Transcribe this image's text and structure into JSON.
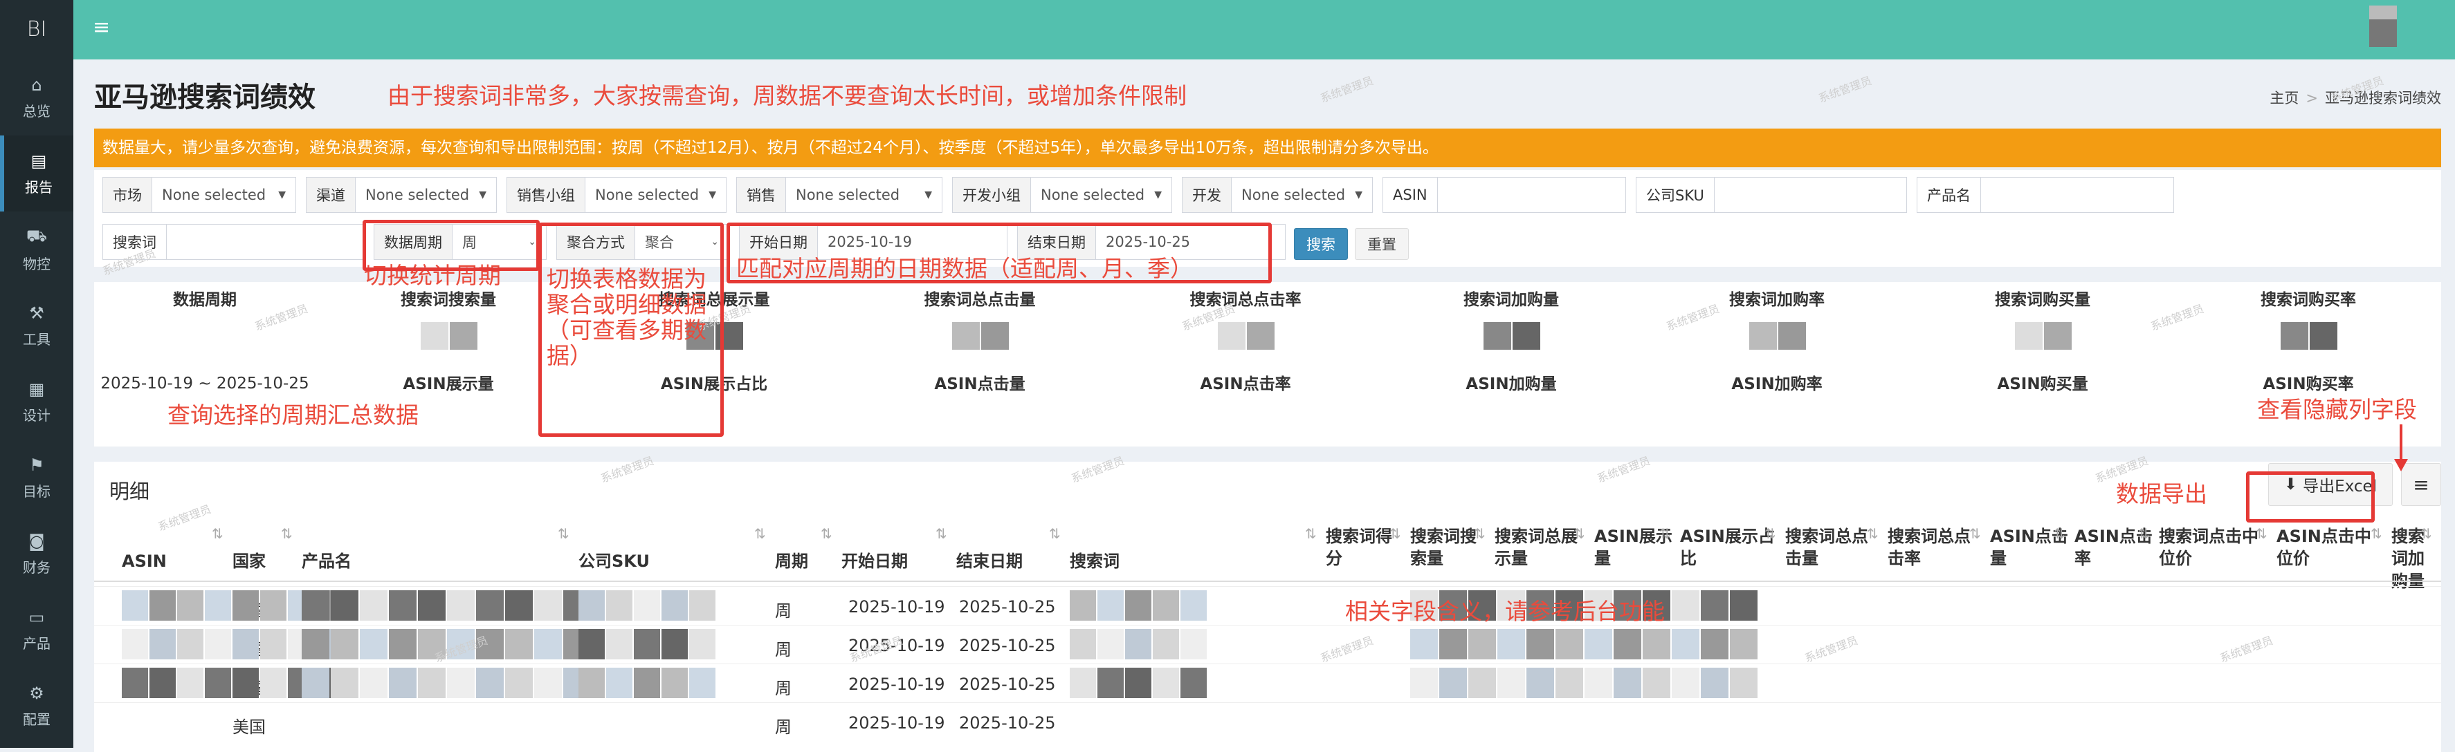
{
  "app": {
    "logo": "BI"
  },
  "sidebar": {
    "items": [
      {
        "icon": "home-icon",
        "glyph": "⌂",
        "label": "总览"
      },
      {
        "icon": "file-icon",
        "glyph": "▤",
        "label": "报告",
        "active": true
      },
      {
        "icon": "truck-icon",
        "glyph": "⛟",
        "label": "物控"
      },
      {
        "icon": "wrench-icon",
        "glyph": "⚒",
        "label": "工具"
      },
      {
        "icon": "design-icon",
        "glyph": "▦",
        "label": "设计"
      },
      {
        "icon": "flag-icon",
        "glyph": "⚑",
        "label": "目标"
      },
      {
        "icon": "money-icon",
        "glyph": "◙",
        "label": "财务"
      },
      {
        "icon": "desktop-icon",
        "glyph": "▭",
        "label": "产品"
      },
      {
        "icon": "cogs-icon",
        "glyph": "⚙",
        "label": "配置"
      }
    ]
  },
  "header": {
    "menu_glyph": "≡"
  },
  "page": {
    "title": "亚马逊搜索词绩效",
    "breadcrumb": {
      "home": "主页",
      "separator": ">",
      "current": "亚马逊搜索词绩效"
    },
    "notice": "数据量大，请少量多次查询，避免浪费资源，每次查询和导出限制范围：按周（不超过12月）、按月（不超过24个月）、按季度（不超过5年），单次最多导出10万条，超出限制请分多次导出。"
  },
  "filters": {
    "market": {
      "label": "市场",
      "value": "None selected"
    },
    "channel": {
      "label": "渠道",
      "value": "None selected"
    },
    "sales_group": {
      "label": "销售小组",
      "value": "None selected"
    },
    "sales": {
      "label": "销售",
      "value": "None selected"
    },
    "dev_group": {
      "label": "开发小组",
      "value": "None selected"
    },
    "dev": {
      "label": "开发",
      "value": "None selected"
    },
    "asin": {
      "label": "ASIN",
      "value": ""
    },
    "sku": {
      "label": "公司SKU",
      "value": ""
    },
    "product": {
      "label": "产品名",
      "value": ""
    },
    "keyword": {
      "label": "搜索词",
      "value": ""
    },
    "period": {
      "label": "数据周期",
      "value": "周"
    },
    "agg": {
      "label": "聚合方式",
      "value": "聚合"
    },
    "start": {
      "label": "开始日期",
      "value": "2025-10-19"
    },
    "end": {
      "label": "结束日期",
      "value": "2025-10-25"
    },
    "search_btn": "搜索",
    "reset_btn": "重置"
  },
  "summary": {
    "period_header": "数据周期",
    "period_value": "2025-10-19 ~ 2025-10-25",
    "headers": [
      "搜索词搜索量",
      "搜索词总展示量",
      "搜索词总点击量",
      "搜索词总点击率",
      "搜索词加购量",
      "搜索词加购率",
      "搜索词购买量",
      "搜索词购买率"
    ],
    "sub_headers": [
      "ASIN展示量",
      "ASIN展示占比",
      "ASIN点击量",
      "ASIN点击率",
      "ASIN加购量",
      "ASIN加购率",
      "ASIN购买量",
      "ASIN购买率"
    ]
  },
  "detail": {
    "title": "明细",
    "export_label": "导出Excel",
    "columns_glyph": "≡",
    "columns": [
      {
        "label": "ASIN"
      },
      {
        "label": "国家"
      },
      {
        "label": "产品名"
      },
      {
        "label": "公司SKU"
      },
      {
        "label": "周期"
      },
      {
        "label": "开始日期"
      },
      {
        "label": "结束日期"
      },
      {
        "label": "搜索词"
      },
      {
        "label": "搜索词得分"
      },
      {
        "label": "搜索词搜索量"
      },
      {
        "label": "搜索词总展示量"
      },
      {
        "label": "ASIN展示量"
      },
      {
        "label": "ASIN展示占比"
      },
      {
        "label": "搜索词总点击量"
      },
      {
        "label": "搜索词总点击率"
      },
      {
        "label": "ASIN点击量"
      },
      {
        "label": "ASIN点击率"
      },
      {
        "label": "搜索词点击中位价"
      },
      {
        "label": "ASIN点击中位价"
      },
      {
        "label": "搜索词加购量"
      }
    ],
    "rows": [
      {
        "country": "美国",
        "period": "周",
        "start": "2025-10-19",
        "end": "2025-10-25"
      },
      {
        "country": "美国",
        "period": "周",
        "start": "2025-10-19",
        "end": "2025-10-25"
      },
      {
        "country": "美国",
        "period": "周",
        "start": "2025-10-19",
        "end": "2025-10-25"
      },
      {
        "country": "美国",
        "period": "周",
        "start": "2025-10-19",
        "end": "2025-10-25"
      }
    ]
  },
  "annotations": {
    "title_note": "由于搜索词非常多，大家按需查询，周数据不要查询太长时间，或增加条件限制",
    "period_note": "切换统计周期",
    "agg_note": "切换表格数据为聚合或明细数据（可查看多期数据）",
    "date_note": "匹配对应周期的日期数据（适配周、月、季）",
    "summary_note": "查询选择的周期汇总数据",
    "hidden_cols_note": "查看隐藏列字段",
    "export_note": "数据导出",
    "fields_note": "相关字段含义，请参考后台功能"
  },
  "watermark": "系统管理员",
  "colors": {
    "accent": "#53c0ae",
    "sidebar": "#222d32",
    "notice": "#f39c12",
    "primary": "#3c8dbc",
    "annotation": "#ea4b3c"
  }
}
